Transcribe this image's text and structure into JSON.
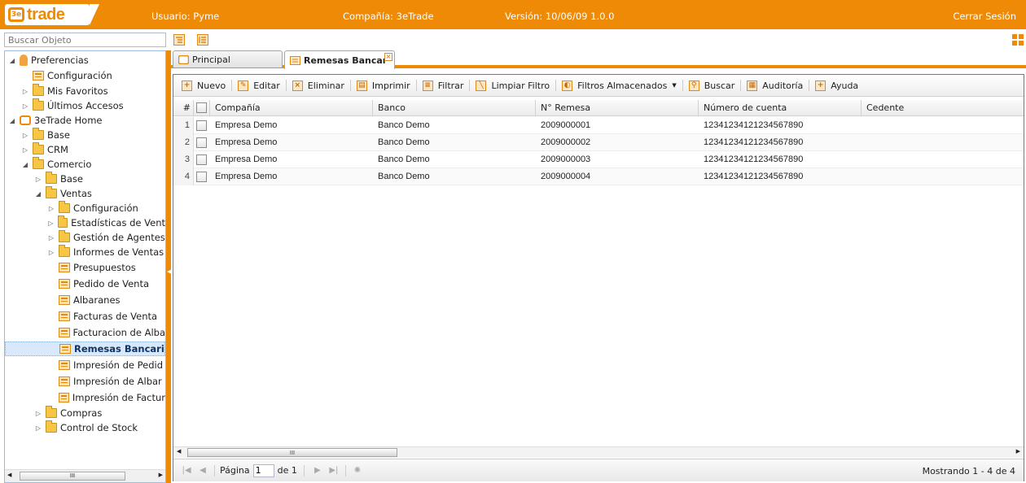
{
  "header": {
    "logo_text": "trade",
    "logo_mark": "3e",
    "user": "Usuario: Pyme",
    "company": "Compañía: 3eTrade",
    "version": "Versión: 10/06/09 1.0.0",
    "logout": "Cerrar Sesión"
  },
  "search": {
    "placeholder": "Buscar Objeto"
  },
  "tree": {
    "items": [
      {
        "label": "Preferencias",
        "icon": "person-icon",
        "expander": "◢"
      },
      {
        "label": "Configuración",
        "icon": "leaf-icon",
        "expander": ""
      },
      {
        "label": "Mis Favoritos",
        "icon": "folder-icon",
        "expander": "▷"
      },
      {
        "label": "Últimos Accesos",
        "icon": "folder-icon",
        "expander": "▷"
      },
      {
        "label": "3eTrade Home",
        "icon": "home-icon",
        "expander": "◢"
      },
      {
        "label": "Base",
        "icon": "folder-icon",
        "expander": "▷"
      },
      {
        "label": "CRM",
        "icon": "folder-icon",
        "expander": "▷"
      },
      {
        "label": "Comercio",
        "icon": "folder-icon",
        "expander": "◢"
      },
      {
        "label": "Base",
        "icon": "folder-icon",
        "expander": "▷"
      },
      {
        "label": "Ventas",
        "icon": "folder-icon",
        "expander": "◢"
      },
      {
        "label": "Configuración",
        "icon": "folder-icon",
        "expander": "▷"
      },
      {
        "label": "Estadísticas de Vent",
        "icon": "folder-icon",
        "expander": "▷"
      },
      {
        "label": "Gestión de Agentes",
        "icon": "folder-icon",
        "expander": "▷"
      },
      {
        "label": "Informes de Ventas",
        "icon": "folder-icon",
        "expander": "▷"
      },
      {
        "label": "Presupuestos",
        "icon": "leaf-icon",
        "expander": ""
      },
      {
        "label": "Pedido de Venta",
        "icon": "leaf-icon",
        "expander": ""
      },
      {
        "label": "Albaranes",
        "icon": "leaf-icon",
        "expander": ""
      },
      {
        "label": "Facturas de Venta",
        "icon": "leaf-icon",
        "expander": ""
      },
      {
        "label": "Facturacion de Alba",
        "icon": "leaf-icon",
        "expander": ""
      },
      {
        "label": "Remesas Bancari",
        "icon": "leaf-icon",
        "expander": "",
        "selected": true
      },
      {
        "label": "Impresión de Pedid",
        "icon": "leaf-icon",
        "expander": ""
      },
      {
        "label": "Impresión de Albar",
        "icon": "leaf-icon",
        "expander": ""
      },
      {
        "label": "Impresión de Factur",
        "icon": "leaf-icon",
        "expander": ""
      },
      {
        "label": "Compras",
        "icon": "folder-icon",
        "expander": "▷"
      },
      {
        "label": "Control de Stock",
        "icon": "folder-icon",
        "expander": "▷"
      }
    ]
  },
  "tabs": [
    {
      "label": "Principal",
      "active": false
    },
    {
      "label": "Remesas Bancar",
      "active": true
    }
  ],
  "actions": [
    {
      "label": "Nuevo",
      "icon": "plus-icon"
    },
    {
      "label": "Editar",
      "icon": "edit-icon"
    },
    {
      "label": "Eliminar",
      "icon": "delete-icon"
    },
    {
      "label": "Imprimir",
      "icon": "print-icon"
    },
    {
      "label": "Filtrar",
      "icon": "filter-icon"
    },
    {
      "label": "Limpiar Filtro",
      "icon": "clear-filter-icon"
    },
    {
      "label": "Filtros Almacenados",
      "icon": "stored-filters-icon",
      "dropdown": true
    },
    {
      "label": "Buscar",
      "icon": "search-icon"
    },
    {
      "label": "Auditoría",
      "icon": "audit-icon"
    },
    {
      "label": "Ayuda",
      "icon": "help-icon"
    }
  ],
  "grid": {
    "columns": [
      "#",
      "Compañía",
      "Banco",
      "N° Remesa",
      "Número de cuenta",
      "Cedente"
    ],
    "rows": [
      {
        "n": "1",
        "compania": "Empresa Demo",
        "banco": "Banco Demo",
        "remesa": "2009000001",
        "cuenta": "12341234121234567890",
        "cedente": ""
      },
      {
        "n": "2",
        "compania": "Empresa Demo",
        "banco": "Banco Demo",
        "remesa": "2009000002",
        "cuenta": "12341234121234567890",
        "cedente": ""
      },
      {
        "n": "3",
        "compania": "Empresa Demo",
        "banco": "Banco Demo",
        "remesa": "2009000003",
        "cuenta": "12341234121234567890",
        "cedente": ""
      },
      {
        "n": "4",
        "compania": "Empresa Demo",
        "banco": "Banco Demo",
        "remesa": "2009000004",
        "cuenta": "12341234121234567890",
        "cedente": ""
      }
    ]
  },
  "pager": {
    "page_label": "Página",
    "page_value": "1",
    "of_label": "de 1",
    "status": "Mostrando 1 - 4 de 4"
  },
  "scroll": {
    "thumb_glyph": "III",
    "left_arrow": "◀",
    "right_arrow": "▶"
  },
  "colors": {
    "accent": "#ee8a05",
    "selection": "#d9e8fb"
  }
}
